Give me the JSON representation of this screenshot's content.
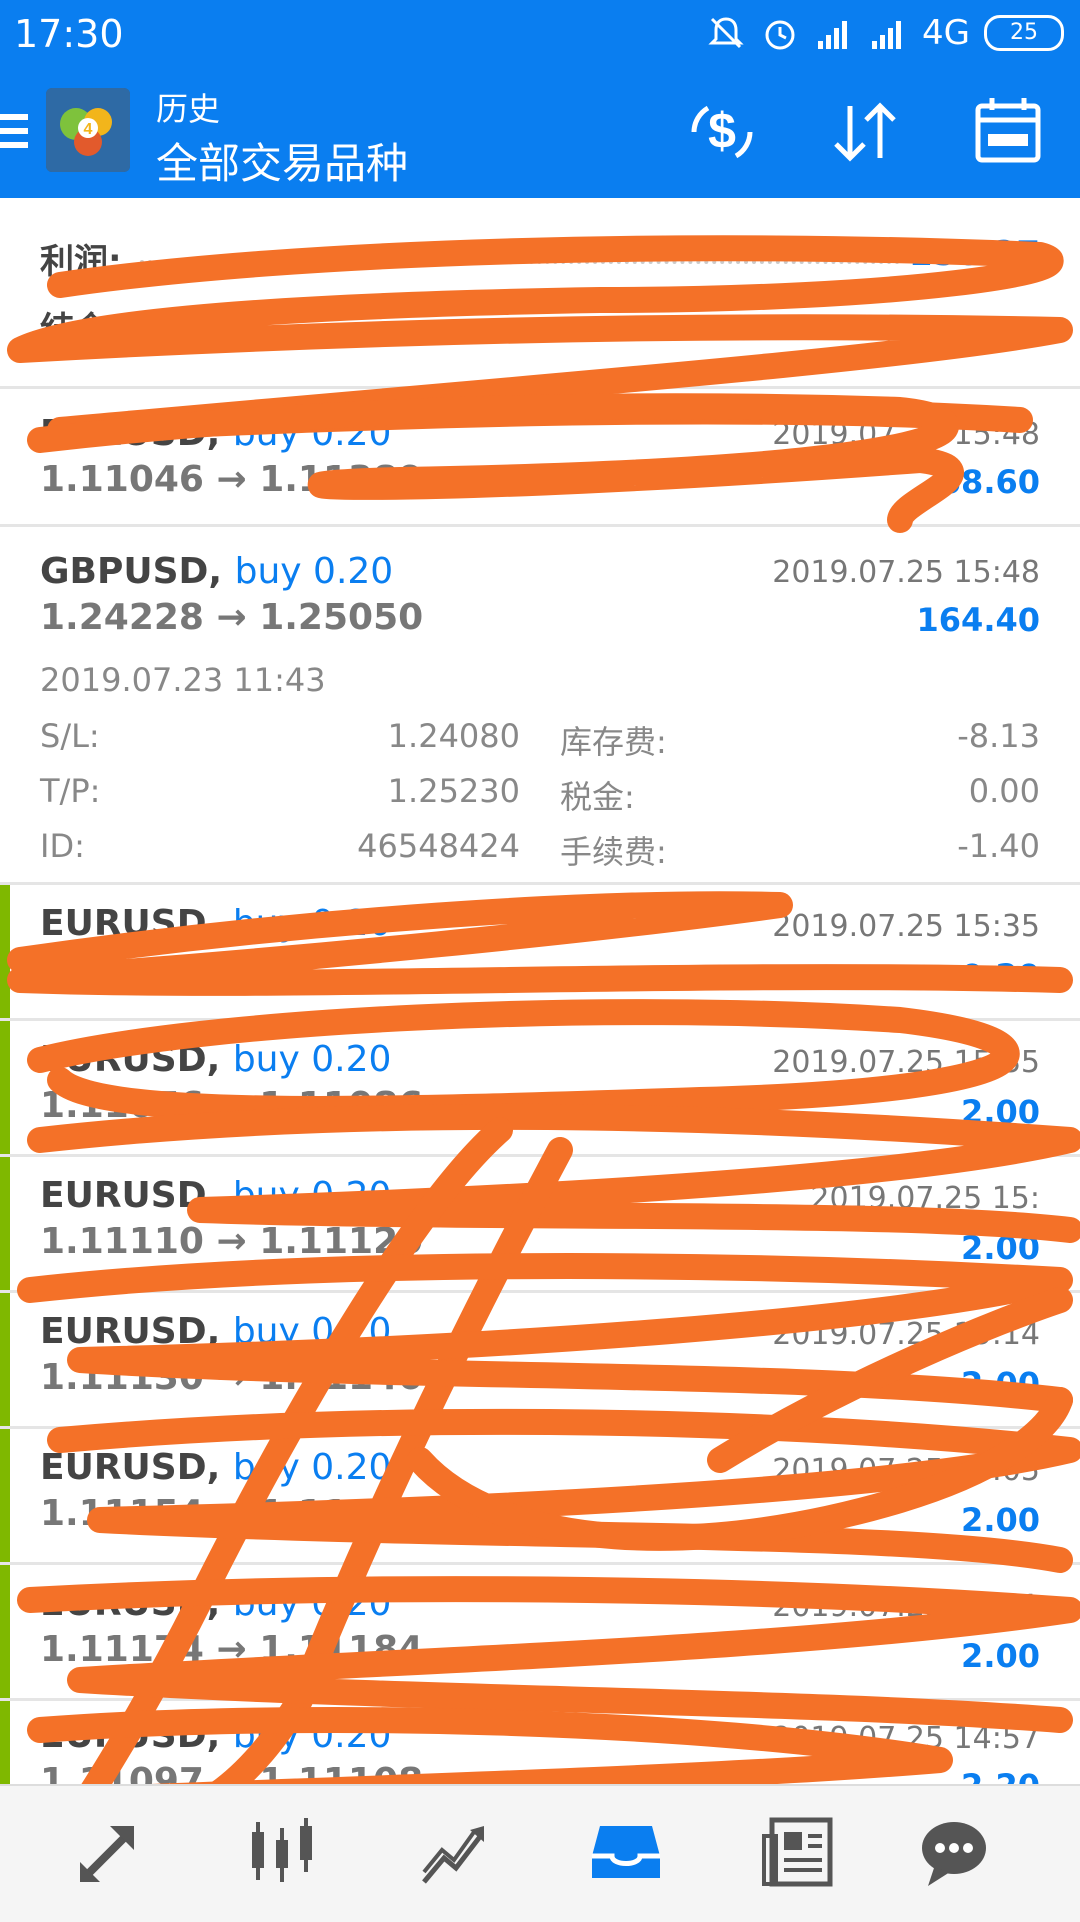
{
  "status_bar": {
    "time": "17:30",
    "network": "4G",
    "battery": "25",
    "icons": [
      "mute-icon",
      "alarm-icon",
      "signal-icon",
      "signal-icon"
    ]
  },
  "app_bar": {
    "subtitle": "历史",
    "title": "全部交易品种",
    "buttons": [
      "deposit-icon",
      "sort-icon",
      "calendar-icon"
    ]
  },
  "summary": {
    "profit_label": "利润:",
    "profit_value": "156.27",
    "balance_label": "结余:"
  },
  "trades": [
    {
      "symbol": "EURUSD,",
      "action": "buy 0.20",
      "price": "1.11046 → 1.11389",
      "date": "2019.07.25 15:48",
      "profit": "68.60"
    },
    {
      "symbol": "GBPUSD,",
      "action": "buy 0.20",
      "price": "1.24228 → 1.25050",
      "date": "2019.07.25 15:48",
      "profit": "164.40",
      "details": {
        "open_time": "2019.07.23 11:43",
        "sl_label": "S/L:",
        "sl_value": "1.24080",
        "tp_label": "T/P:",
        "tp_value": "1.25230",
        "id_label": "ID:",
        "id_value": "46548424",
        "swap_label": "库存费:",
        "swap_value": "-8.13",
        "tax_label": "税金:",
        "tax_value": "0.00",
        "fee_label": "手续费:",
        "fee_value": "-1.40"
      }
    },
    {
      "symbol": "EURUSD,",
      "action": "buy 0.20",
      "price": "",
      "date": "2019.07.25 15:35",
      "profit": "0.20"
    },
    {
      "symbol": "EURUSD,",
      "action": "buy 0.20",
      "price": "1.11076 → 1.11086",
      "date": "2019.07.25 15:35",
      "profit": "2.00"
    },
    {
      "symbol": "EURUSD,",
      "action": "buy 0.20",
      "price": "1.11110 → 1.11120",
      "date": "2019.07.25 15:",
      "profit": "2.00"
    },
    {
      "symbol": "EURUSD,",
      "action": "buy 0.20",
      "price": "1.11130 → 1.11140",
      "date": "2019.07.25 15:14",
      "profit": "2.00"
    },
    {
      "symbol": "EURUSD,",
      "action": "buy 0.20",
      "price": "1.11154 → 1.11164",
      "date": "2019.07.25 15:05",
      "profit": "2.00"
    },
    {
      "symbol": "EURUSD,",
      "action": "buy 0.20",
      "price": "1.11174 → 1.11184",
      "date": "2019.07.25 15:01",
      "profit": "2.00"
    },
    {
      "symbol": "EURUSD,",
      "action": "buy 0.20",
      "price": "1.11097 → 1.11108",
      "date": "2019.07.25 14:57",
      "profit": "2.20"
    }
  ],
  "bottom_nav": [
    "trade-icon",
    "chart-icon",
    "analytics-icon",
    "history-icon",
    "news-icon",
    "chat-icon"
  ],
  "colors": {
    "accent": "#0a7ef0",
    "scribble": "#f47128",
    "bar": "#7fb800"
  }
}
